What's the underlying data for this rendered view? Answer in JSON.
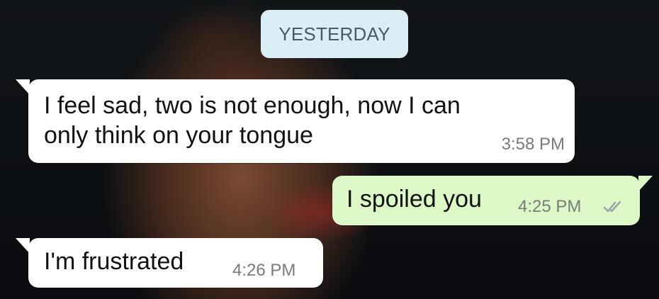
{
  "date_chip": "YESTERDAY",
  "messages": [
    {
      "direction": "incoming",
      "lines": [
        "I feel sad, two is not enough, now I can",
        "only think on your tongue"
      ],
      "time": "3:58 PM"
    },
    {
      "direction": "outgoing",
      "text": "I spoiled you",
      "time": "4:25 PM",
      "status": "read"
    },
    {
      "direction": "incoming",
      "text": "I'm frustrated",
      "time": "4:26 PM"
    }
  ],
  "colors": {
    "incoming_bubble": "#ffffff",
    "outgoing_bubble": "#dcf8c6",
    "date_chip": "#d9eef5",
    "time_text": "#7a7a7a",
    "read_check": "#9aa3a8"
  },
  "icons": {
    "read_receipt": "double-check-icon"
  }
}
